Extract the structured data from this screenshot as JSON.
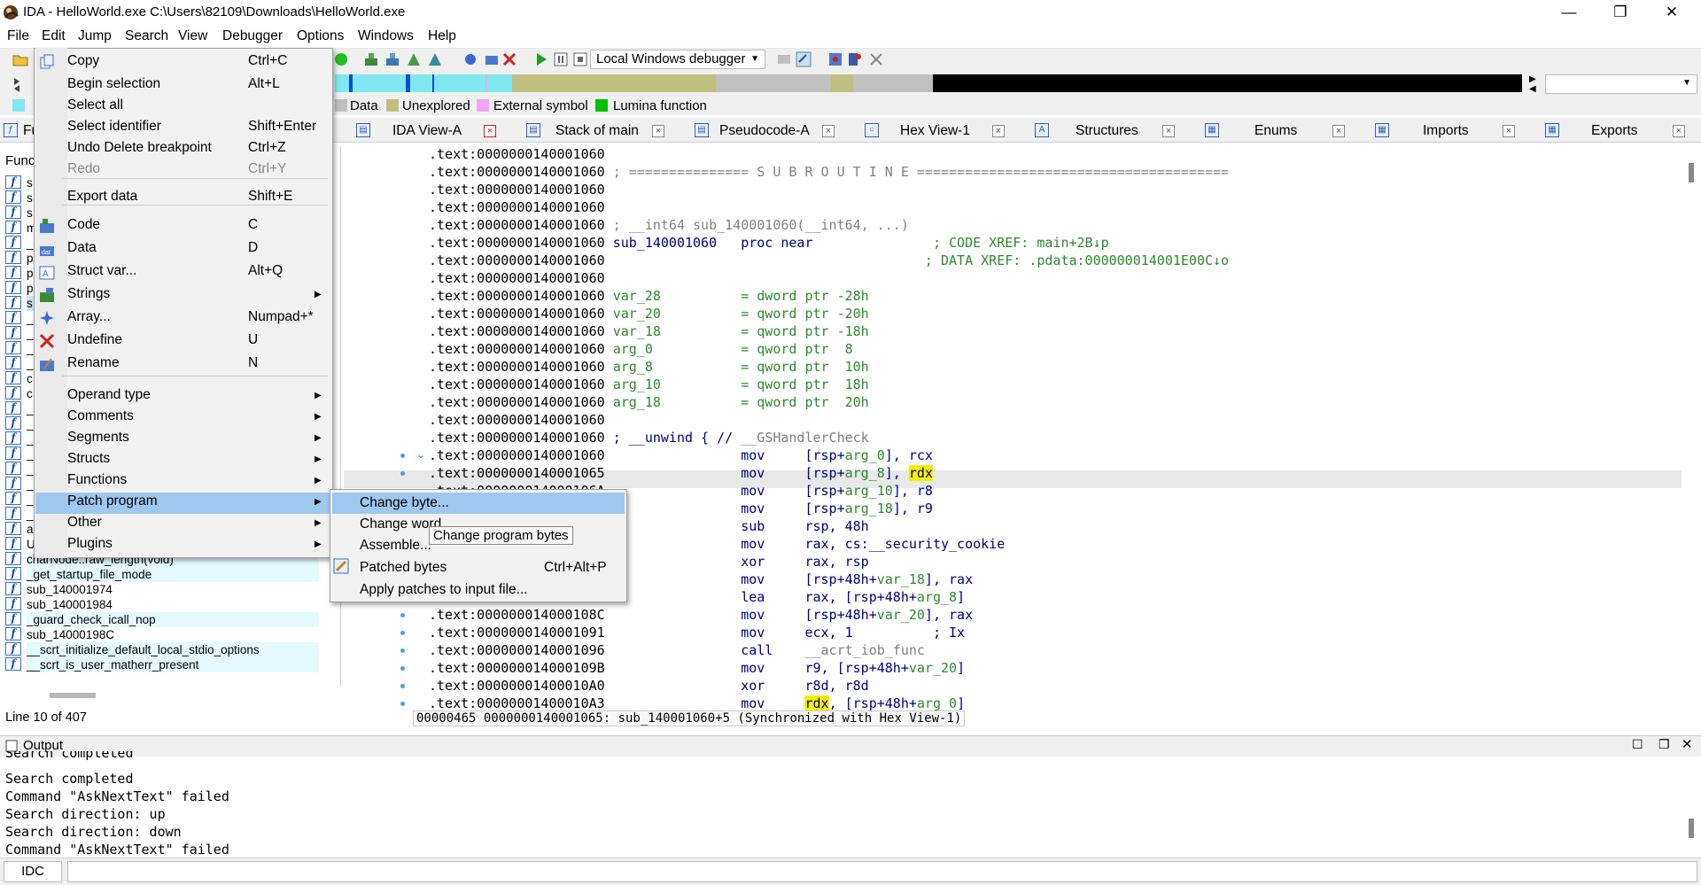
{
  "window": {
    "title": "IDA - HelloWorld.exe C:\\Users\\82109\\Downloads\\HelloWorld.exe",
    "minimize_glyph": "—",
    "maximize_glyph": "❐",
    "close_glyph": "✕"
  },
  "menubar": [
    "File",
    "Edit",
    "Jump",
    "Search",
    "View",
    "Debugger",
    "Options",
    "Windows",
    "Help"
  ],
  "toolbar": {
    "debugger": "Local Windows debugger"
  },
  "legend": [
    "Data",
    "Unexplored",
    "External symbol",
    "Lumina function"
  ],
  "legend_colors": [
    "#c0c0c0",
    "#c0bf80",
    "#f4a4f4",
    "#00c000"
  ],
  "tabs": [
    {
      "label": "IDA View-A",
      "icon": "ida-view-icon"
    },
    {
      "label": "Stack of main",
      "icon": "stack-icon"
    },
    {
      "label": "Pseudocode-A",
      "icon": "pseudocode-icon"
    },
    {
      "label": "Hex View-1",
      "icon": "hex-view-icon"
    },
    {
      "label": "Structures",
      "icon": "structures-icon"
    },
    {
      "label": "Enums",
      "icon": "enums-icon"
    },
    {
      "label": "Imports",
      "icon": "imports-icon"
    },
    {
      "label": "Exports",
      "icon": "exports-icon"
    }
  ],
  "functions_panel": {
    "title_partial": "Fu",
    "header_partial": "Func",
    "visible_names": [
      "s",
      "s",
      "s",
      "m",
      "_",
      "p",
      "p",
      "p",
      "s",
      "_",
      "_",
      "_",
      "_",
      "c",
      "c",
      "_",
      "_",
      "_",
      "_",
      "_",
      "_",
      "_",
      "_",
      "a",
      "UserMathErrorFunction",
      "charNode::raw_length(void)",
      "_get_startup_file_mode",
      "sub_140001974",
      "sub_140001984",
      "_guard_check_icall_nop",
      "sub_14000198C",
      "__scrt_initialize_default_local_stdio_options",
      "__scrt_is_user_matherr_present"
    ],
    "status": "Line 10 of 407"
  },
  "disasm": {
    "lines": [
      {
        "addr": ".text:0000000140001060",
        "parts": []
      },
      {
        "addr": ".text:0000000140001060",
        "parts": [
          {
            "t": " ; =============== S U B R O U T I N E =======================================",
            "c": "c-gray"
          }
        ]
      },
      {
        "addr": ".text:0000000140001060",
        "parts": []
      },
      {
        "addr": ".text:0000000140001060",
        "parts": []
      },
      {
        "addr": ".text:0000000140001060",
        "parts": [
          {
            "t": " ; __int64 sub_140001060(__int64, ...)",
            "c": "c-gray"
          }
        ]
      },
      {
        "addr": ".text:0000000140001060",
        "parts": [
          {
            "t": " sub_140001060",
            "c": "c-navy"
          },
          {
            "t": "   proc near",
            "c": "c-navy"
          },
          {
            "t": "               ; CODE XREF: main+2B↓p",
            "c": "c-green"
          }
        ]
      },
      {
        "addr": ".text:0000000140001060",
        "parts": [
          {
            "t": "                                        ; DATA XREF: .pdata:000000014001E00C↓o",
            "c": "c-green"
          }
        ]
      },
      {
        "addr": ".text:0000000140001060",
        "parts": []
      },
      {
        "addr": ".text:0000000140001060",
        "parts": [
          {
            "t": " var_28",
            "c": "c-green"
          },
          {
            "t": "          = dword ptr -28h",
            "c": "c-green"
          }
        ]
      },
      {
        "addr": ".text:0000000140001060",
        "parts": [
          {
            "t": " var_20",
            "c": "c-green"
          },
          {
            "t": "          = qword ptr -20h",
            "c": "c-green"
          }
        ]
      },
      {
        "addr": ".text:0000000140001060",
        "parts": [
          {
            "t": " var_18",
            "c": "c-green"
          },
          {
            "t": "          = qword ptr -18h",
            "c": "c-green"
          }
        ]
      },
      {
        "addr": ".text:0000000140001060",
        "parts": [
          {
            "t": " arg_0",
            "c": "c-green"
          },
          {
            "t": "           = qword ptr  8",
            "c": "c-green"
          }
        ]
      },
      {
        "addr": ".text:0000000140001060",
        "parts": [
          {
            "t": " arg_8",
            "c": "c-green"
          },
          {
            "t": "           = qword ptr  10h",
            "c": "c-green"
          }
        ]
      },
      {
        "addr": ".text:0000000140001060",
        "parts": [
          {
            "t": " arg_10",
            "c": "c-green"
          },
          {
            "t": "          = qword ptr  18h",
            "c": "c-green"
          }
        ]
      },
      {
        "addr": ".text:0000000140001060",
        "parts": [
          {
            "t": " arg_18",
            "c": "c-green"
          },
          {
            "t": "          = qword ptr  20h",
            "c": "c-green"
          }
        ]
      },
      {
        "addr": ".text:0000000140001060",
        "parts": []
      },
      {
        "addr": ".text:0000000140001060",
        "parts": [
          {
            "t": " ; __unwind { // ",
            "c": "c-navy"
          },
          {
            "t": "__GSHandlerCheck",
            "c": "c-gray"
          }
        ]
      },
      {
        "addr": ".text:0000000140001060",
        "parts": [
          {
            "t": "                 mov     [rsp+",
            "c": "c-navy"
          },
          {
            "t": "arg_0",
            "c": "c-green"
          },
          {
            "t": "], rcx",
            "c": "c-navy"
          }
        ]
      },
      {
        "addr": ".text:0000000140001065",
        "parts": [
          {
            "t": "                 mov     [rsp+",
            "c": "c-navy"
          },
          {
            "t": "arg_8",
            "c": "c-green"
          },
          {
            "t": "], ",
            "c": "c-navy"
          },
          {
            "t": "rdx",
            "c": "c-navy hl"
          }
        ]
      },
      {
        "addr": ".text:000000014000106A",
        "parts": [
          {
            "t": "                 mov     [rsp+",
            "c": "c-navy"
          },
          {
            "t": "arg_10",
            "c": "c-green"
          },
          {
            "t": "], r8",
            "c": "c-navy"
          }
        ]
      },
      {
        "addr": ".text:000000014000106F",
        "parts": [
          {
            "t": "                 mov     [rsp+",
            "c": "c-navy"
          },
          {
            "t": "arg_18",
            "c": "c-green"
          },
          {
            "t": "], r9",
            "c": "c-navy"
          }
        ]
      },
      {
        "addr": ".text:0000000140001074",
        "parts": [
          {
            "t": "                 sub     rsp, 48h",
            "c": "c-navy"
          }
        ]
      },
      {
        "addr": ".text:0000000140001078",
        "parts": [
          {
            "t": "                 mov     rax, cs:",
            "c": "c-navy"
          },
          {
            "t": "__security_cookie",
            "c": "c-navy"
          }
        ]
      },
      {
        "addr": ".text:000000014000107F",
        "parts": [
          {
            "t": "                 xor     rax, rsp",
            "c": "c-navy"
          }
        ]
      },
      {
        "addr": ".text:0000000140001082",
        "parts": [
          {
            "t": "                 mov     [rsp+48h+",
            "c": "c-navy"
          },
          {
            "t": "var_18",
            "c": "c-green"
          },
          {
            "t": "], rax",
            "c": "c-navy"
          }
        ]
      },
      {
        "addr": ".text:0000000140001087",
        "parts": [
          {
            "t": "                 lea     rax, [rsp+48h+",
            "c": "c-navy"
          },
          {
            "t": "arg_8",
            "c": "c-green"
          },
          {
            "t": "]",
            "c": "c-navy"
          }
        ]
      },
      {
        "addr": ".text:000000014000108C",
        "parts": [
          {
            "t": "                 mov     [rsp+48h+",
            "c": "c-navy"
          },
          {
            "t": "var_20",
            "c": "c-green"
          },
          {
            "t": "], rax",
            "c": "c-navy"
          }
        ]
      },
      {
        "addr": ".text:0000000140001091",
        "parts": [
          {
            "t": "                 mov     ecx, 1",
            "c": "c-navy"
          },
          {
            "t": "          ; Ix",
            "c": "c-navy"
          }
        ]
      },
      {
        "addr": ".text:0000000140001096",
        "parts": [
          {
            "t": "                 call    ",
            "c": "c-navy"
          },
          {
            "t": "__acrt_iob_func",
            "c": "c-gray"
          }
        ]
      },
      {
        "addr": ".text:000000014000109B",
        "parts": [
          {
            "t": "                 mov     r9, [rsp+48h+",
            "c": "c-navy"
          },
          {
            "t": "var_20",
            "c": "c-green"
          },
          {
            "t": "]",
            "c": "c-navy"
          }
        ]
      },
      {
        "addr": ".text:00000001400010A0",
        "parts": [
          {
            "t": "                 xor     r8d, r8d",
            "c": "c-navy"
          }
        ]
      },
      {
        "addr": ".text:00000001400010A3",
        "parts": [
          {
            "t": "                 mov     ",
            "c": "c-navy"
          },
          {
            "t": "rdx",
            "c": "c-navy hl"
          },
          {
            "t": ", [rsp+48h+",
            "c": "c-navy"
          },
          {
            "t": "arg_0",
            "c": "c-green"
          },
          {
            "t": "]",
            "c": "c-navy"
          }
        ]
      }
    ],
    "status": "00000465 0000000140001065: sub_140001060+5 (Synchronized with Hex View-1)"
  },
  "output": {
    "title": "Output",
    "lines": [
      "Search completed",
      "Search completed",
      "Command \"AskNextText\" failed",
      "Search direction: up",
      "Search direction: down",
      "Command \"AskNextText\" failed"
    ],
    "idc_label": "IDC"
  },
  "edit_menu": {
    "items": [
      {
        "label": "Copy",
        "shortcut": "Ctrl+C",
        "icon": "copy-icon"
      },
      {
        "label": "Begin selection",
        "shortcut": "Alt+L"
      },
      {
        "label": "Select all",
        "shortcut": ""
      },
      {
        "label": "Select identifier",
        "shortcut": "Shift+Enter"
      },
      {
        "label": "Undo Delete breakpoint",
        "shortcut": "Ctrl+Z"
      },
      {
        "label": "Redo",
        "shortcut": "Ctrl+Y",
        "disabled": true
      },
      {
        "label": "Export data",
        "shortcut": "Shift+E"
      },
      {
        "label": "Code",
        "shortcut": "C",
        "icon": "code-icon"
      },
      {
        "label": "Data",
        "shortcut": "D",
        "icon": "data-icon"
      },
      {
        "label": "Struct var...",
        "shortcut": "Alt+Q",
        "icon": "struct-var-icon"
      },
      {
        "label": "Strings",
        "shortcut": "",
        "submenu": true,
        "icon": "strings-icon"
      },
      {
        "label": "Array...",
        "shortcut": "Numpad+*",
        "icon": "array-icon"
      },
      {
        "label": "Undefine",
        "shortcut": "U",
        "icon": "undefine-icon"
      },
      {
        "label": "Rename",
        "shortcut": "N",
        "icon": "rename-icon"
      },
      {
        "label": "Operand type",
        "submenu": true
      },
      {
        "label": "Comments",
        "submenu": true
      },
      {
        "label": "Segments",
        "submenu": true
      },
      {
        "label": "Structs",
        "submenu": true
      },
      {
        "label": "Functions",
        "submenu": true
      },
      {
        "label": "Patch program",
        "submenu": true
      },
      {
        "label": "Other",
        "submenu": true
      },
      {
        "label": "Plugins",
        "submenu": true
      }
    ],
    "arrow": "▶"
  },
  "patch_menu": {
    "items": [
      {
        "label": "Change byte...",
        "shortcut": ""
      },
      {
        "label": "Change word...",
        "shortcut": ""
      },
      {
        "label": "Assemble...",
        "shortcut": ""
      },
      {
        "label": "Patched bytes",
        "shortcut": "Ctrl+Alt+P"
      },
      {
        "label": "Apply patches to input file...",
        "shortcut": ""
      }
    ],
    "tooltip": "Change program bytes"
  }
}
